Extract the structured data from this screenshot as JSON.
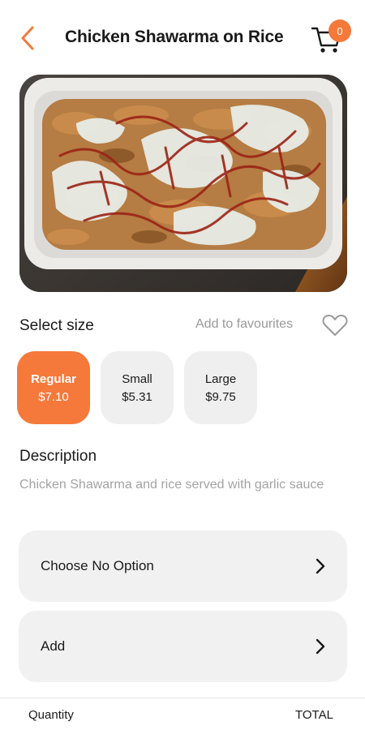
{
  "header": {
    "title": "Chicken Shawarma on Rice",
    "cart_count": "0",
    "back_icon": "chevron-left-icon",
    "cart_icon": "shopping-cart-icon"
  },
  "product": {
    "image_alt": "Chicken Shawarma on Rice photo"
  },
  "size": {
    "heading": "Select size",
    "favourites_label": "Add to favourites",
    "favourites_icon": "heart-outline-icon",
    "options": [
      {
        "name": "Regular",
        "price": "$7.10",
        "selected": true
      },
      {
        "name": "Small",
        "price": "$5.31",
        "selected": false
      },
      {
        "name": "Large",
        "price": "$9.75",
        "selected": false
      }
    ]
  },
  "description": {
    "heading": "Description",
    "text": "Chicken Shawarma and rice served with garlic sauce"
  },
  "options": [
    {
      "label": "Choose No Option"
    },
    {
      "label": "Add"
    }
  ],
  "footer": {
    "quantity_label": "Quantity",
    "total_label": "TOTAL"
  },
  "colors": {
    "accent": "#F5793B",
    "card_bg": "#EFEFEF",
    "muted_text": "#A3A3A3"
  }
}
